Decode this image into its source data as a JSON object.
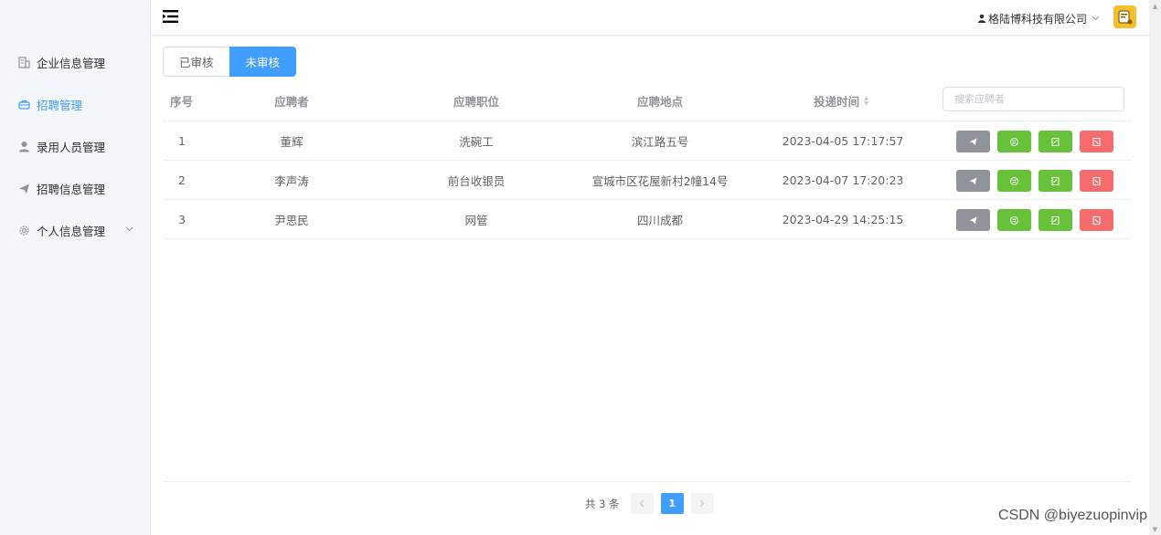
{
  "sidebar": {
    "items": [
      {
        "label": "企业信息管理",
        "icon": "building-icon"
      },
      {
        "label": "招聘管理",
        "icon": "briefcase-icon",
        "active": true
      },
      {
        "label": "录用人员管理",
        "icon": "user-icon"
      },
      {
        "label": "招聘信息管理",
        "icon": "send-icon"
      },
      {
        "label": "个人信息管理",
        "icon": "gear-icon"
      }
    ]
  },
  "header": {
    "company": "格陆博科技有限公司"
  },
  "tabs": [
    {
      "label": "已审核"
    },
    {
      "label": "未审核",
      "active": true
    }
  ],
  "table": {
    "columns": [
      "序号",
      "应聘者",
      "应聘职位",
      "应聘地点",
      "投递时间"
    ],
    "search_placeholder": "搜索应聘者",
    "rows": [
      {
        "idx": "1",
        "name": "董辉",
        "position": "洗碗工",
        "location": "滨江路五号",
        "time": "2023-04-05 17:17:57"
      },
      {
        "idx": "2",
        "name": "李声涛",
        "position": "前台收银员",
        "location": "宣城市区花屋新村2幢14号",
        "time": "2023-04-07 17:20:23"
      },
      {
        "idx": "3",
        "name": "尹思民",
        "position": "网管",
        "location": "四川成都",
        "time": "2023-04-29 14:25:15"
      }
    ]
  },
  "pagination": {
    "total": "共 3 条",
    "current": "1"
  },
  "watermark": "CSDN @biyezuopinvip",
  "colors": {
    "primary": "#409eff",
    "success": "#67c23a",
    "danger": "#f56c6c",
    "info": "#909399"
  }
}
